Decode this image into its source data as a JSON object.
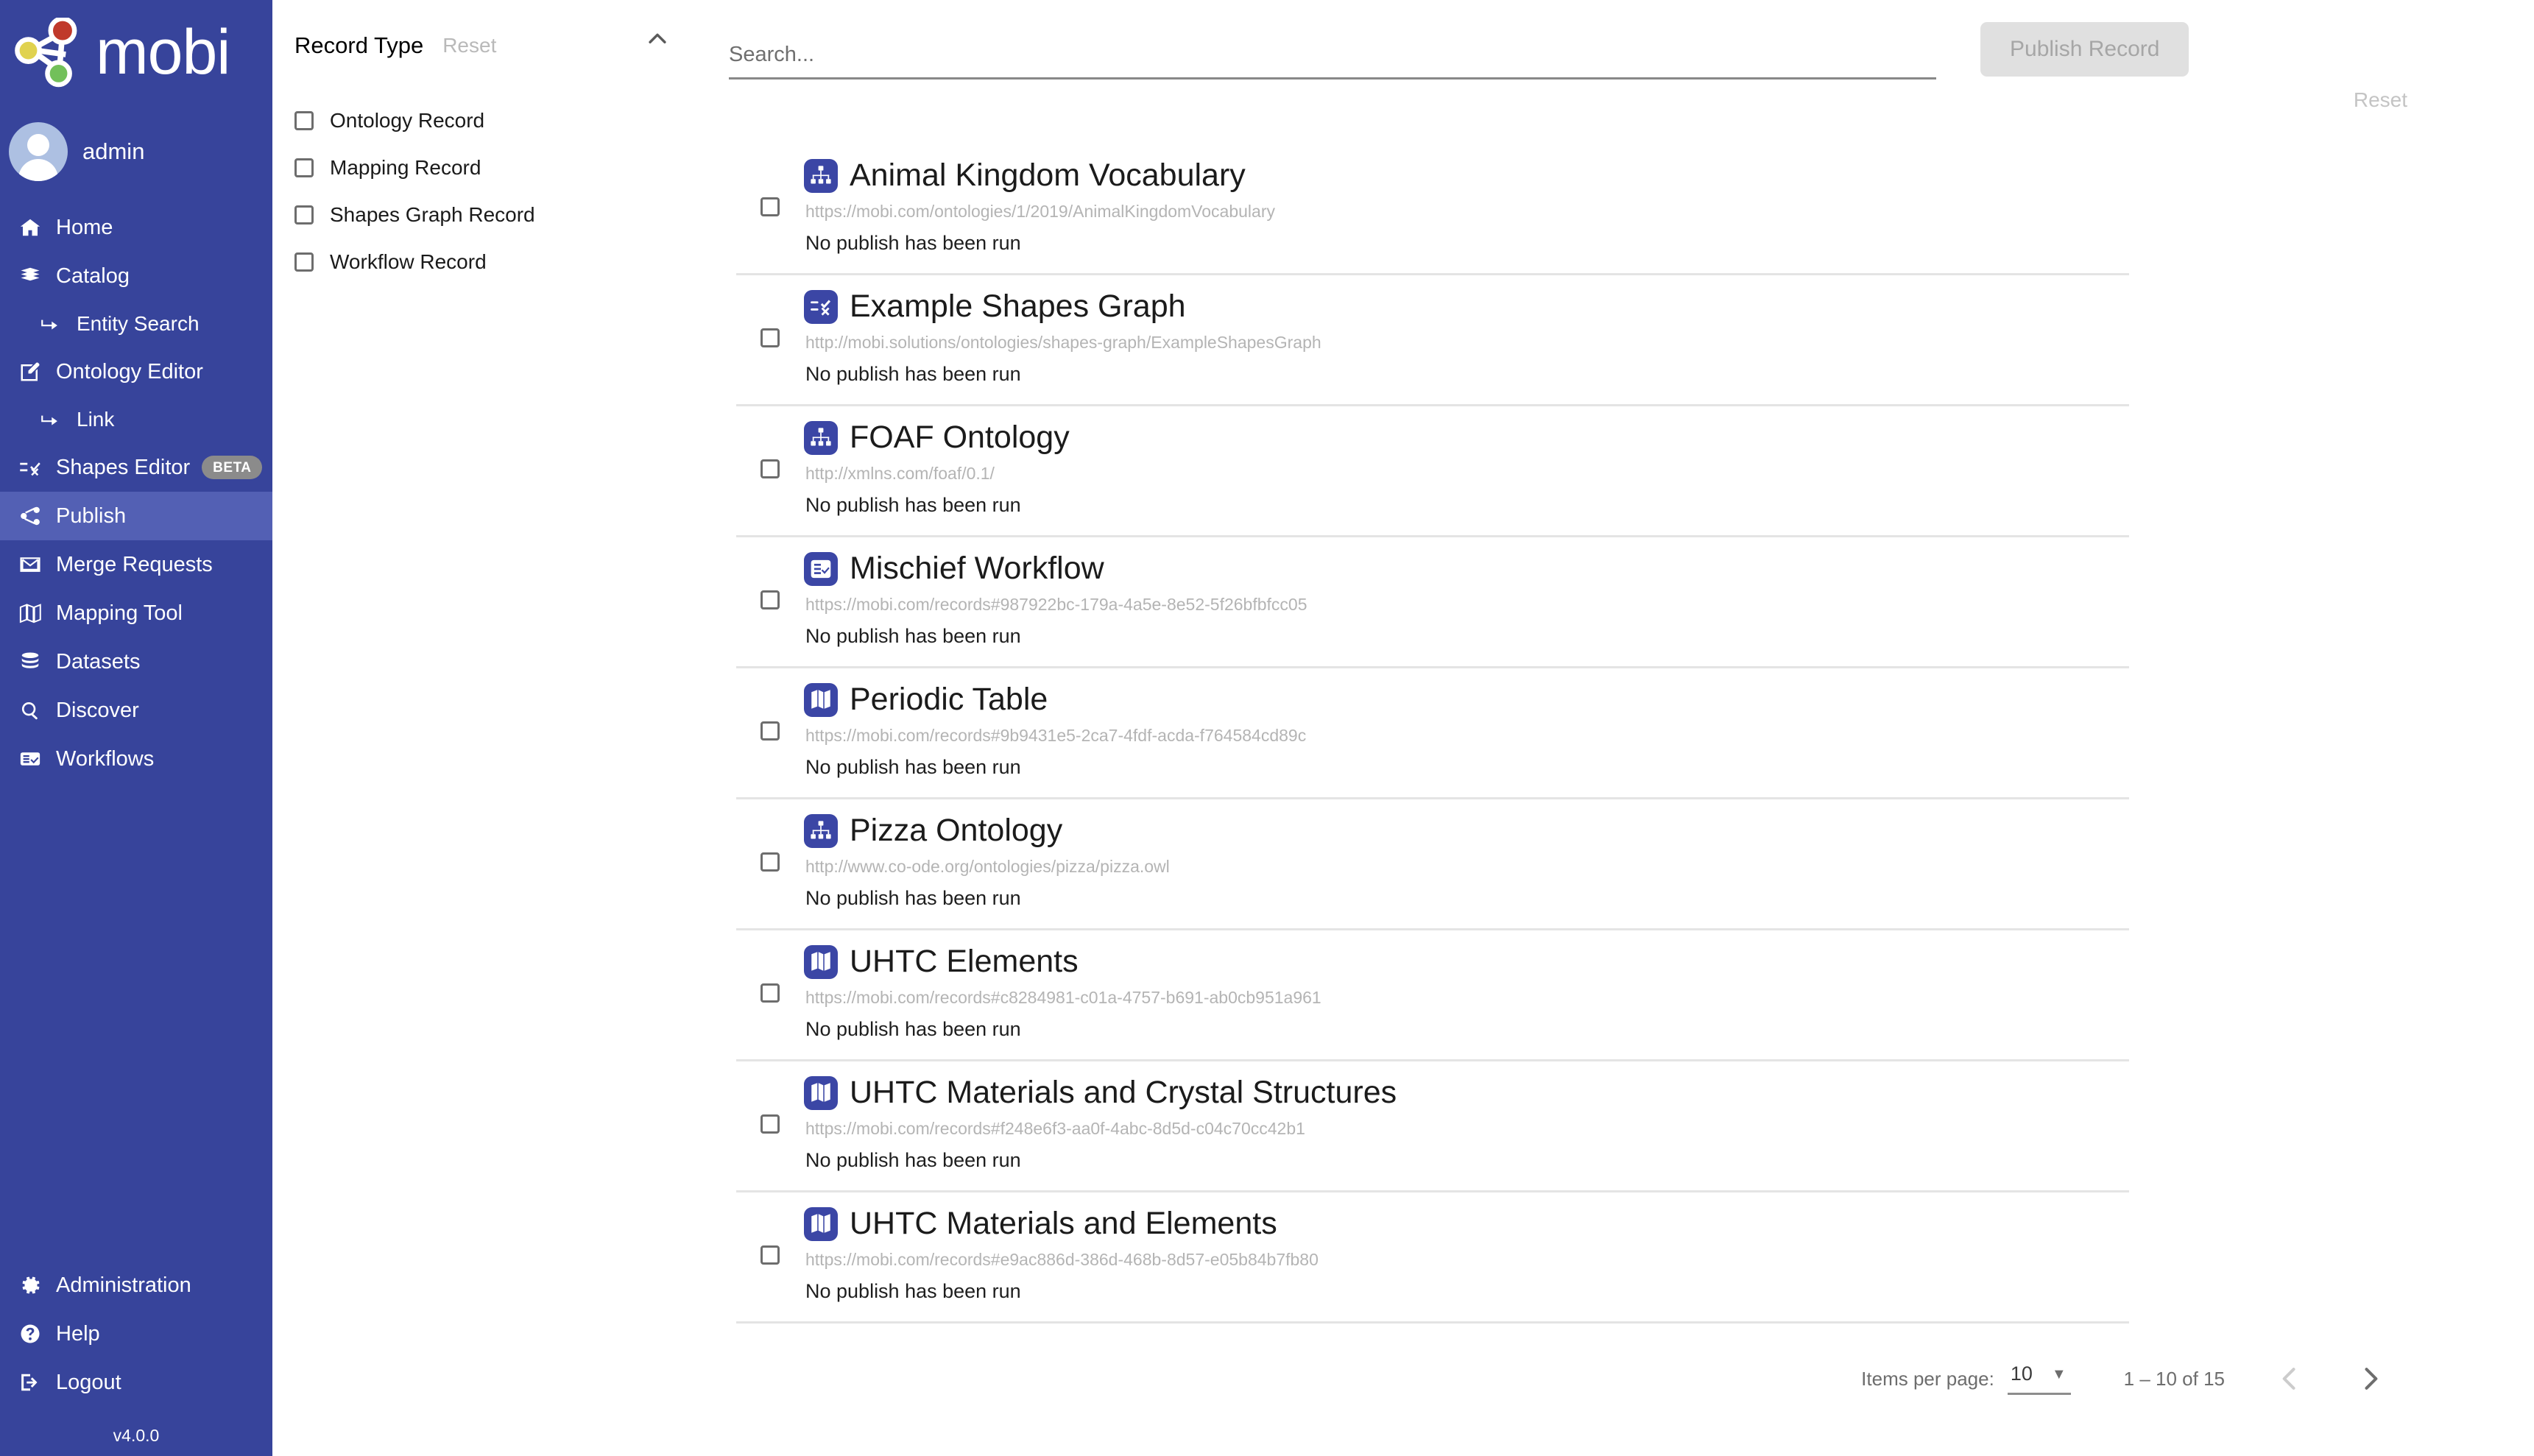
{
  "brand": {
    "name": "mobi",
    "logo_icon": "mobi-graph-logo"
  },
  "user": {
    "name": "admin",
    "avatar_icon": "user-avatar-icon"
  },
  "sidebar": {
    "version": "v4.0.0",
    "items": [
      {
        "label": "Home",
        "icon": "home-icon",
        "sub": false,
        "active": false
      },
      {
        "label": "Catalog",
        "icon": "book-icon",
        "sub": false,
        "active": false
      },
      {
        "label": "Entity Search",
        "icon": "arrow-turn-icon",
        "sub": true,
        "active": false
      },
      {
        "label": "Ontology Editor",
        "icon": "edit-square-icon",
        "sub": false,
        "active": false
      },
      {
        "label": "Link",
        "icon": "arrow-turn-icon",
        "sub": true,
        "active": false
      },
      {
        "label": "Shapes Editor",
        "icon": "shapes-icon",
        "sub": false,
        "active": false,
        "badge": "BETA"
      },
      {
        "label": "Publish",
        "icon": "share-icon",
        "sub": false,
        "active": true
      },
      {
        "label": "Merge Requests",
        "icon": "envelope-icon",
        "sub": false,
        "active": false
      },
      {
        "label": "Mapping Tool",
        "icon": "map-icon",
        "sub": false,
        "active": false
      },
      {
        "label": "Datasets",
        "icon": "database-icon",
        "sub": false,
        "active": false
      },
      {
        "label": "Discover",
        "icon": "search-icon",
        "sub": false,
        "active": false
      },
      {
        "label": "Workflows",
        "icon": "workflow-icon",
        "sub": false,
        "active": false
      }
    ],
    "bottom_items": [
      {
        "label": "Administration",
        "icon": "gear-icon"
      },
      {
        "label": "Help",
        "icon": "question-circle-icon"
      },
      {
        "label": "Logout",
        "icon": "logout-icon"
      }
    ]
  },
  "filters": {
    "title": "Record Type",
    "reset_label": "Reset",
    "collapse_icon": "chevron-up-icon",
    "options": [
      {
        "label": "Ontology Record",
        "checked": false
      },
      {
        "label": "Mapping Record",
        "checked": false
      },
      {
        "label": "Shapes Graph Record",
        "checked": false
      },
      {
        "label": "Workflow Record",
        "checked": false
      }
    ]
  },
  "toolbar": {
    "search_placeholder": "Search...",
    "search_value": "",
    "publish_label": "Publish Record",
    "list_reset_label": "Reset"
  },
  "records": [
    {
      "title": "Animal Kingdom Vocabulary",
      "iri": "https://mobi.com/ontologies/1/2019/AnimalKingdomVocabulary",
      "status": "No publish has been run",
      "icon": "ontology-record-icon",
      "checked": false
    },
    {
      "title": "Example Shapes Graph",
      "iri": "http://mobi.solutions/ontologies/shapes-graph/ExampleShapesGraph",
      "status": "No publish has been run",
      "icon": "shapes-graph-record-icon",
      "checked": false
    },
    {
      "title": "FOAF Ontology",
      "iri": "http://xmlns.com/foaf/0.1/",
      "status": "No publish has been run",
      "icon": "ontology-record-icon",
      "checked": false
    },
    {
      "title": "Mischief Workflow",
      "iri": "https://mobi.com/records#987922bc-179a-4a5e-8e52-5f26bfbfcc05",
      "status": "No publish has been run",
      "icon": "workflow-record-icon",
      "checked": false
    },
    {
      "title": "Periodic Table",
      "iri": "https://mobi.com/records#9b9431e5-2ca7-4fdf-acda-f764584cd89c",
      "status": "No publish has been run",
      "icon": "mapping-record-icon",
      "checked": false
    },
    {
      "title": "Pizza Ontology",
      "iri": "http://www.co-ode.org/ontologies/pizza/pizza.owl",
      "status": "No publish has been run",
      "icon": "ontology-record-icon",
      "checked": false
    },
    {
      "title": "UHTC Elements",
      "iri": "https://mobi.com/records#c8284981-c01a-4757-b691-ab0cb951a961",
      "status": "No publish has been run",
      "icon": "mapping-record-icon",
      "checked": false
    },
    {
      "title": "UHTC Materials and Crystal Structures",
      "iri": "https://mobi.com/records#f248e6f3-aa0f-4abc-8d5d-c04c70cc42b1",
      "status": "No publish has been run",
      "icon": "mapping-record-icon",
      "checked": false
    },
    {
      "title": "UHTC Materials and Elements",
      "iri": "https://mobi.com/records#e9ac886d-386d-468b-8d57-e05b84b7fb80",
      "status": "No publish has been run",
      "icon": "mapping-record-icon",
      "checked": false
    }
  ],
  "paginator": {
    "items_per_page_label": "Items per page:",
    "items_per_page_value": "10",
    "range_label": "1 – 10 of 15",
    "prev_icon": "chevron-left-icon",
    "next_icon": "chevron-right-icon"
  },
  "colors": {
    "sidebar_bg": "#37449b",
    "sidebar_active": "#5360b4",
    "record_icon_bg": "#3b46a5",
    "muted_text": "#b4b4b4"
  }
}
